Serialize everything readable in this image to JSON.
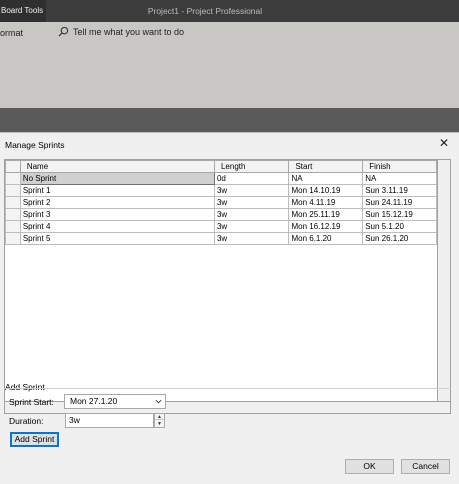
{
  "titlebar": {
    "context_tab": "Board Tools",
    "app_title": "Project1  -  Project Professional"
  },
  "ribbon": {
    "tab_format": "ormat",
    "tell_me": "Tell me what you want to do",
    "tell_me_icon": "search-icon"
  },
  "dialog": {
    "title": "Manage Sprints",
    "close_icon": "close-icon",
    "columns": [
      "Name",
      "Length",
      "Start",
      "Finish"
    ],
    "rows": [
      {
        "name": "No Sprint",
        "length": "0d",
        "start": "NA",
        "finish": "NA"
      },
      {
        "name": "Sprint 1",
        "length": "3w",
        "start": "Mon 14.10.19",
        "finish": "Sun 3.11.19"
      },
      {
        "name": "Sprint 2",
        "length": "3w",
        "start": "Mon 4.11.19",
        "finish": "Sun 24.11.19"
      },
      {
        "name": "Sprint 3",
        "length": "3w",
        "start": "Mon 25.11.19",
        "finish": "Sun 15.12.19"
      },
      {
        "name": "Sprint 4",
        "length": "3w",
        "start": "Mon 16.12.19",
        "finish": "Sun 5.1.20"
      },
      {
        "name": "Sprint 5",
        "length": "3w",
        "start": "Mon 6.1.20",
        "finish": "Sun 26.1.20"
      }
    ],
    "add_sprint": {
      "section_label": "Add Sprint",
      "start_label": "Sprint Start:",
      "start_value": "Mon 27.1.20",
      "duration_label": "Duration:",
      "duration_value": "3w",
      "add_button": "Add Sprint"
    },
    "ok_button": "OK",
    "cancel_button": "Cancel"
  }
}
